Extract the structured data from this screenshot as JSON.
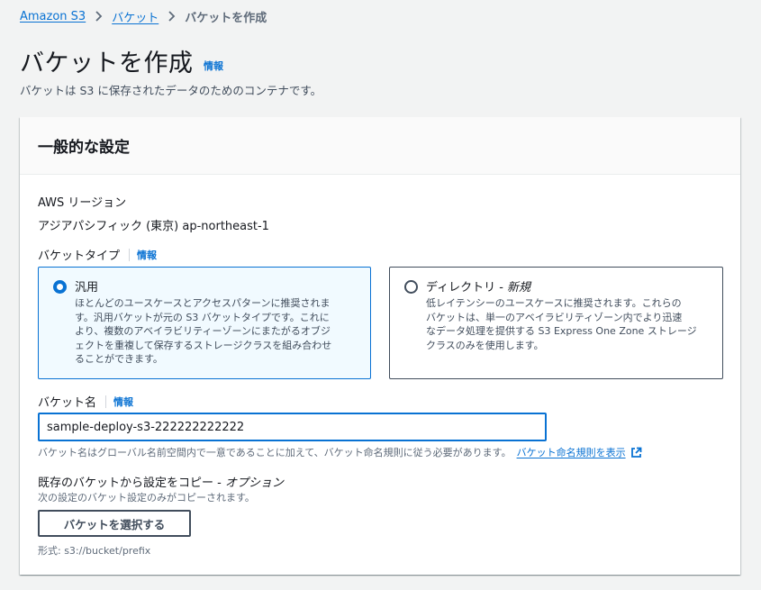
{
  "breadcrumb": {
    "items": [
      "Amazon S3",
      "バケット"
    ],
    "current": "バケットを作成"
  },
  "header": {
    "title": "バケットを作成",
    "info": "情報",
    "description": "バケットは S3 に保存されたデータのためのコンテナです。"
  },
  "general": {
    "title": "一般的な設定",
    "region_label": "AWS リージョン",
    "region_value": "アジアパシフィック (東京) ap-northeast-1",
    "bucket_type_label": "バケットタイプ",
    "bucket_type_info": "情報",
    "options": [
      {
        "title": "汎用",
        "selected": true,
        "desc_lines": [
          "ほとんどのユースケースとアクセスパターンに推奨されま",
          "す。汎用バケットが元の S3 バケットタイプです。これに",
          "より、複数のアベイラビリティーゾーンにまたがるオブジ",
          "ェクトを重複して保存するストレージクラスを組み合わせ",
          "ることができます。"
        ]
      },
      {
        "title": "ディレクトリ - ",
        "badge": "新規",
        "selected": false,
        "desc_lines": [
          "低レイテンシーのユースケースに推奨されます。これらの",
          "バケットは、単一のアベイラビリティゾーン内でより迅速",
          "なデータ処理を提供する S3 Express One Zone ストレージ",
          "クラスのみを使用します。"
        ]
      }
    ],
    "bucket_name_label": "バケット名",
    "bucket_name_info": "情報",
    "bucket_name_value": "sample-deploy-s3-222222222222",
    "bucket_name_hint": "バケット名はグローバル名前空間内で一意であることに加えて、バケット命名規則に従う必要があります。",
    "naming_rules_link": "バケット命名規則を表示",
    "copy_label": "既存のバケットから設定をコピー - ",
    "copy_optional": "オプション",
    "copy_desc": "次の設定のバケット設定のみがコピーされます。",
    "choose_button": "バケットを選択する",
    "format": "形式: s3://bucket/prefix"
  },
  "colors": {
    "accent": "#0972d3",
    "selected_tile_bg": "#f1faff",
    "text_secondary": "#5f6b7a",
    "page_bg": "#f2f3f3"
  }
}
